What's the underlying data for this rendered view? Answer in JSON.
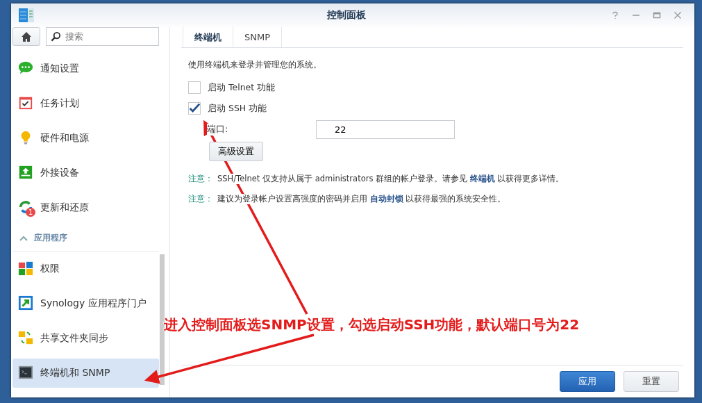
{
  "window": {
    "title": "控制面板"
  },
  "sidebar": {
    "search": {
      "placeholder": "搜索"
    },
    "items": [
      {
        "label": "通知设置",
        "selected": false
      },
      {
        "label": "任务计划",
        "selected": false
      },
      {
        "label": "硬件和电源",
        "selected": false
      },
      {
        "label": "外接设备",
        "selected": false
      },
      {
        "label": "更新和还原",
        "selected": false,
        "badge": "1"
      }
    ],
    "section": {
      "label": "应用程序",
      "expanded": true
    },
    "section_items": [
      {
        "label": "权限",
        "selected": false
      },
      {
        "label": "Synology 应用程序门户",
        "selected": false
      },
      {
        "label": "共享文件夹同步",
        "selected": false
      },
      {
        "label": "终端机和 SNMP",
        "selected": true
      }
    ]
  },
  "tabs": [
    {
      "label": "终端机",
      "selected": true
    },
    {
      "label": "SNMP",
      "selected": false
    }
  ],
  "intro": "使用终端机来登录并管理您的系统。",
  "options": [
    {
      "label": "启动 Telnet 功能",
      "checked": false
    },
    {
      "label": "启动 SSH 功能",
      "checked": true
    }
  ],
  "port": {
    "label": "端口:",
    "value": "22"
  },
  "advanced_button": "高级设置",
  "notes": [
    {
      "label": "注意：",
      "before": "SSH/Telnet 仅支持从属于 administrators 群组的帐户登录。请参见 ",
      "link": "终端机",
      "after": " 以获得更多详情。"
    },
    {
      "label": "注意：",
      "before": "建议为登录帐户设置高强度的密码并启用 ",
      "link": "自动封锁",
      "after": " 以获得最强的系统安全性。"
    }
  ],
  "buttons": [
    {
      "label": "应用",
      "kind": "primary"
    },
    {
      "label": "重置",
      "kind": "secondary"
    }
  ],
  "annotation": {
    "text": "进入控制面板选SNMP设置，勾选启动SSH功能，默认端口号为22"
  }
}
